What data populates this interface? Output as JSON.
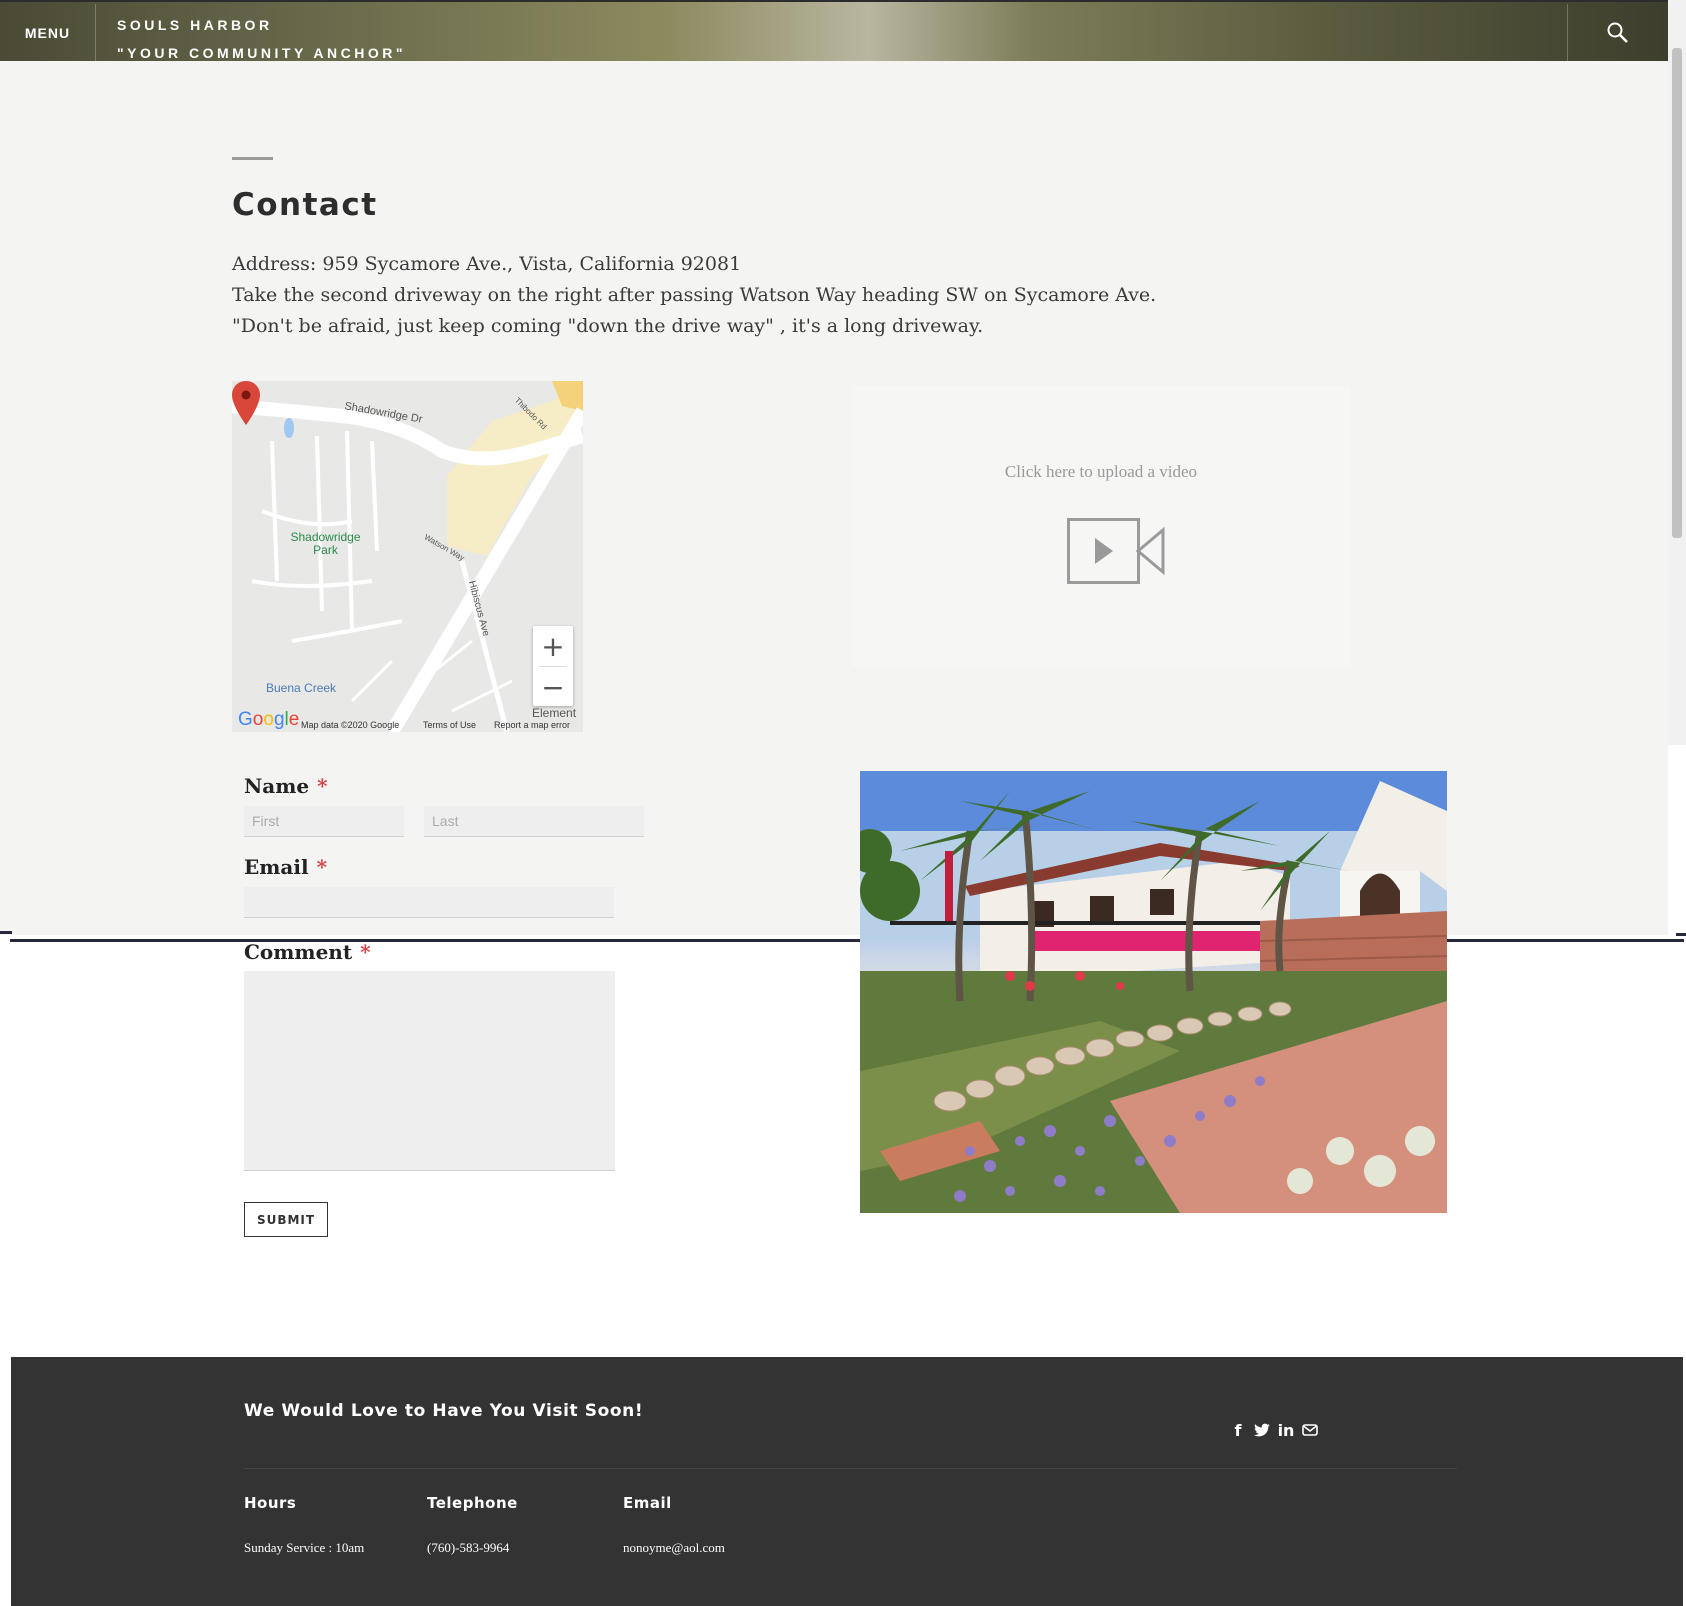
{
  "header": {
    "menu_label": "MENU",
    "site_name": "SOULS HARBOR",
    "tagline": "\"YOUR COMMUNITY ANCHOR\""
  },
  "contact": {
    "title": "Contact",
    "address_line": "Address: 959 Sycamore Ave., Vista, California 92081",
    "directions_line": "Take the second driveway on the right after passing Watson Way heading SW on Sycamore Ave.",
    "note_line": "\"Don't be afraid, just keep coming \"down the drive way\" , it's a long driveway."
  },
  "map": {
    "labels": {
      "shadowridge_dr": "Shadowridge Dr",
      "park": "Shadowridge Park",
      "watson": "Watson Way",
      "hibiscus": "Hibiscus Ave",
      "buena_creek": "Buena Creek",
      "thibodo": "Thibodo Rd",
      "element": "Element"
    },
    "google": "Google",
    "map_data": "Map data ©2020 Google",
    "terms": "Terms of Use",
    "report": "Report a map error",
    "zoom_in": "+",
    "zoom_out": "−"
  },
  "video": {
    "upload_text": "Click here to upload a video"
  },
  "form": {
    "name_label": "Name",
    "email_label": "Email",
    "comment_label": "Comment",
    "required_mark": "*",
    "first_placeholder": "First",
    "last_placeholder": "Last",
    "submit_label": "SUBMIT"
  },
  "footer": {
    "heading": "We Would Love to Have You Visit Soon!",
    "social_icons": [
      "facebook-icon",
      "twitter-icon",
      "linkedin-icon",
      "mail-icon"
    ],
    "hours_title": "Hours",
    "hours_value": "Sunday Service : 10am",
    "telephone_title": "Telephone",
    "telephone_value": "(760)-583-9964",
    "email_title": "Email",
    "email_value": "nonoyme@aol.com"
  },
  "colors": {
    "footer_bg": "#333333",
    "content_bg": "#f4f4f3",
    "required": "#d43f3f",
    "divider": "#27283a"
  }
}
